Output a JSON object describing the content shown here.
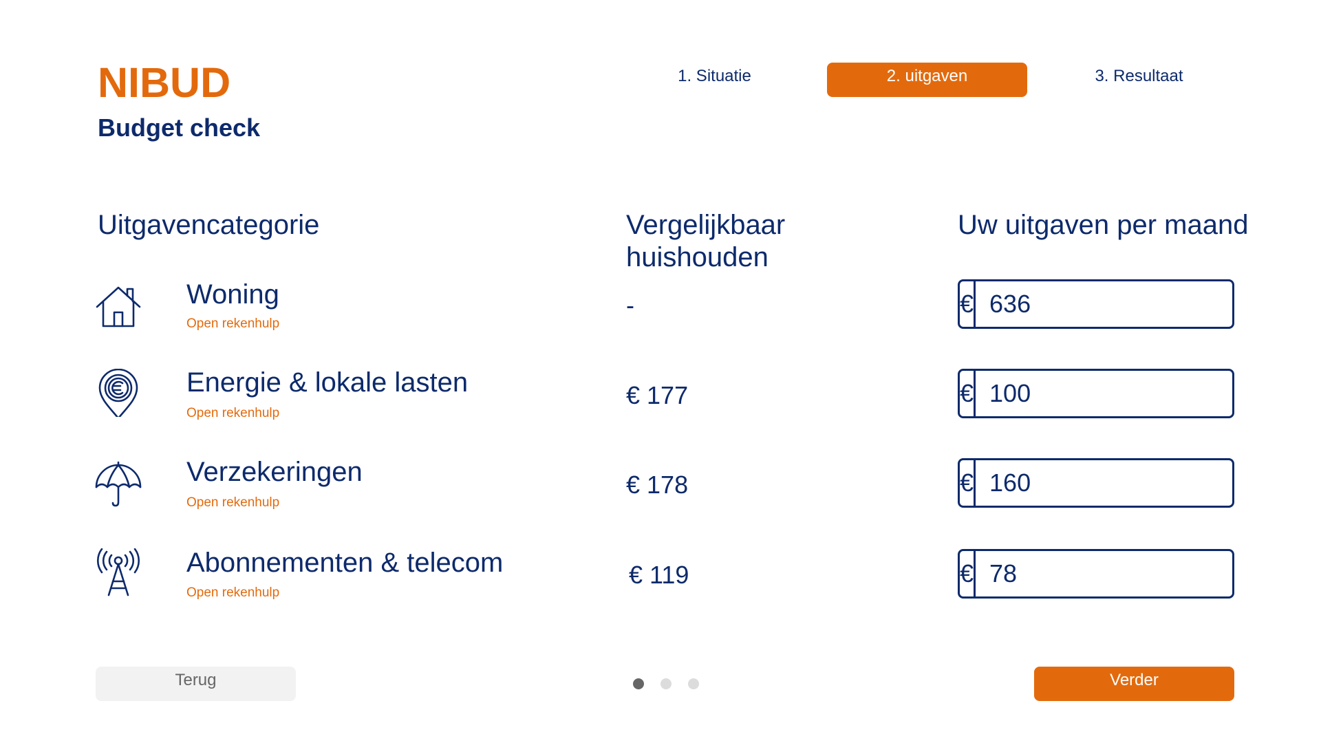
{
  "brand": {
    "name": "NIBUD",
    "subtitle": "Budget check"
  },
  "steps": [
    {
      "label": "1. Situatie",
      "active": false
    },
    {
      "label": "2. uitgaven",
      "active": true
    },
    {
      "label": "3. Resultaat",
      "active": false
    }
  ],
  "columns": {
    "category": "Uitgavencategorie",
    "comparable": "Vergelijkbaar huishouden",
    "own": "Uw uitgaven per maand"
  },
  "rows": [
    {
      "label": "Woning",
      "link": "Open rekenhulp",
      "comparable": "-",
      "currency": "€",
      "value": "636",
      "icon": "house-icon"
    },
    {
      "label": "Energie & lokale lasten",
      "link": "Open rekenhulp",
      "comparable": "€ 177",
      "currency": "€",
      "value": "100",
      "icon": "euro-pin-icon"
    },
    {
      "label": "Verzekeringen",
      "link": "Open rekenhulp",
      "comparable": "€ 178",
      "currency": "€",
      "value": "160",
      "icon": "umbrella-icon"
    },
    {
      "label": "Abonnementen & telecom",
      "link": "Open rekenhulp",
      "comparable": "€ 119",
      "currency": "€",
      "value": "78",
      "icon": "antenna-tower-icon"
    }
  ],
  "buttons": {
    "back": "Terug",
    "next": "Verder"
  },
  "pagination": {
    "total": 3,
    "current": 1
  },
  "colors": {
    "accent": "#e36a0c",
    "navy": "#0d2a6b",
    "back_button_bg": "#f2f2f2"
  }
}
